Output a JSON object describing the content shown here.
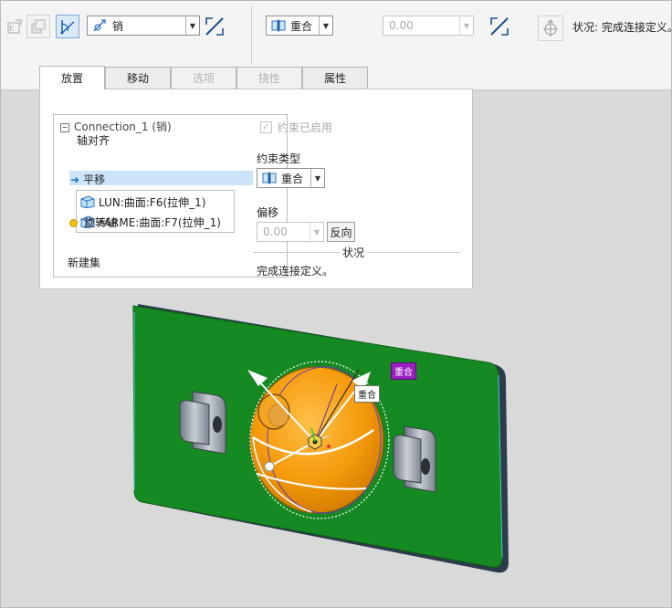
{
  "toolbar": {
    "connection_type_value": "销",
    "constraint_type_value": "重合",
    "offset_value": "0.00",
    "status_label": "状况:",
    "status_value": "完成连接定义。"
  },
  "tabs": [
    {
      "label": "放置",
      "state": "active"
    },
    {
      "label": "移动",
      "state": "normal"
    },
    {
      "label": "选项",
      "state": "disabled"
    },
    {
      "label": "挠性",
      "state": "disabled"
    },
    {
      "label": "属性",
      "state": "normal"
    }
  ],
  "placement": {
    "connection_name": "Connection_1 (销)",
    "axis_align": "轴对齐",
    "translation": "平移",
    "ref1": "LUN:曲面:F6(拉伸_1)",
    "ref2": "FARME:曲面:F7(拉伸_1)",
    "rotation_axis": "旋转轴",
    "new_set": "新建集",
    "constraint_enabled_label": "约束已启用",
    "constraint_type_label": "约束类型",
    "constraint_type_value": "重合",
    "offset_label": "偏移",
    "offset_value": "0.00",
    "reverse_button": "反向",
    "status_title": "状况",
    "status_message": "完成连接定义。"
  },
  "viewport": {
    "tag1": "重合",
    "tag2": "重合"
  },
  "colors": {
    "plate_green": "#158a22",
    "disc_orange": "#f59b0c",
    "tag_purple": "#9b1fc0",
    "selection_blue": "#cce4f7"
  }
}
